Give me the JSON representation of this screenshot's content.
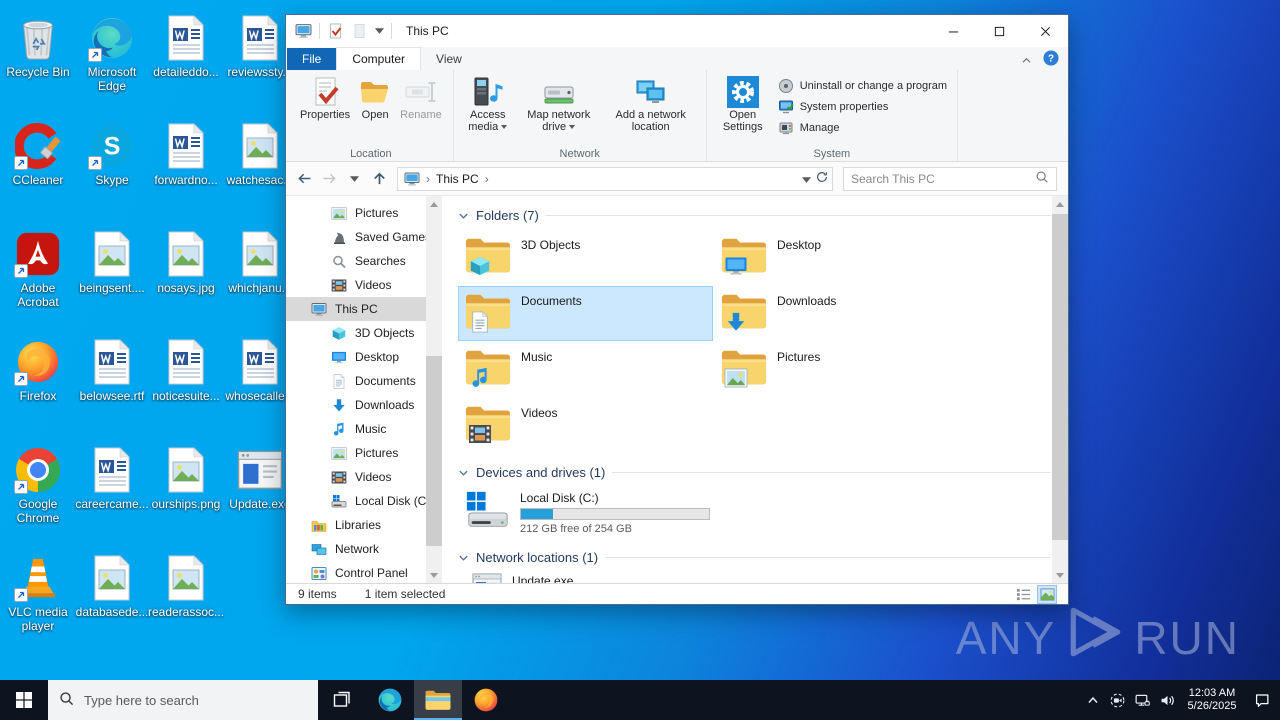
{
  "desktop": {
    "watermark_left": "ANY",
    "watermark_right": "RUN",
    "icons": [
      {
        "label": "Recycle Bin",
        "icon": "recycle-bin",
        "col": 0,
        "row": 0
      },
      {
        "label": "Microsoft Edge",
        "icon": "edge",
        "col": 1,
        "row": 0,
        "shortcut": true
      },
      {
        "label": "detaileddo...",
        "icon": "word-doc",
        "col": 2,
        "row": 0
      },
      {
        "label": "reviewssty...",
        "icon": "word-doc",
        "col": 3,
        "row": 0
      },
      {
        "label": "CCleaner",
        "icon": "ccleaner",
        "col": 0,
        "row": 1,
        "shortcut": true
      },
      {
        "label": "Skype",
        "icon": "skype",
        "col": 1,
        "row": 1,
        "shortcut": true
      },
      {
        "label": "forwardno...",
        "icon": "word-doc",
        "col": 2,
        "row": 1
      },
      {
        "label": "watchesac...",
        "icon": "image-file",
        "col": 3,
        "row": 1
      },
      {
        "label": "Adobe Acrobat",
        "icon": "adobe",
        "col": 0,
        "row": 2,
        "shortcut": true
      },
      {
        "label": "beingsent....",
        "icon": "image-file",
        "col": 1,
        "row": 2
      },
      {
        "label": "nosays.jpg",
        "icon": "image-file",
        "col": 2,
        "row": 2
      },
      {
        "label": "whichjanu...",
        "icon": "image-file",
        "col": 3,
        "row": 2
      },
      {
        "label": "Firefox",
        "icon": "firefox",
        "col": 0,
        "row": 3,
        "shortcut": true
      },
      {
        "label": "belowsee.rtf",
        "icon": "word-doc",
        "col": 1,
        "row": 3
      },
      {
        "label": "noticesuite...",
        "icon": "word-doc",
        "col": 2,
        "row": 3
      },
      {
        "label": "whosecalle...",
        "icon": "word-doc",
        "col": 3,
        "row": 3
      },
      {
        "label": "Google Chrome",
        "icon": "chrome",
        "col": 0,
        "row": 4,
        "shortcut": true
      },
      {
        "label": "careercame...",
        "icon": "word-doc",
        "col": 1,
        "row": 4
      },
      {
        "label": "ourships.png",
        "icon": "image-file",
        "col": 2,
        "row": 4
      },
      {
        "label": "Update.exe",
        "icon": "exe-window",
        "col": 3,
        "row": 4
      },
      {
        "label": "VLC media player",
        "icon": "vlc",
        "col": 0,
        "row": 5,
        "shortcut": true
      },
      {
        "label": "databasede...",
        "icon": "image-file",
        "col": 1,
        "row": 5
      },
      {
        "label": "readerassoc...",
        "icon": "image-file",
        "col": 2,
        "row": 5
      }
    ]
  },
  "window": {
    "title": "This PC",
    "tabs": {
      "file": "File",
      "computer": "Computer",
      "view": "View"
    },
    "ribbon": {
      "groups": [
        {
          "name": "Location",
          "buttons": [
            {
              "label": "Properties",
              "icon": "properties"
            },
            {
              "label": "Open",
              "icon": "open-folder"
            },
            {
              "label": "Rename",
              "icon": "rename",
              "disabled": true
            }
          ]
        },
        {
          "name": "Network",
          "buttons": [
            {
              "label": "Access media",
              "icon": "access-media",
              "menu": true
            },
            {
              "label": "Map network drive",
              "icon": "map-drive",
              "menu": true
            },
            {
              "label": "Add a network location",
              "icon": "add-network"
            }
          ]
        },
        {
          "name": "System",
          "buttons": [
            {
              "label": "Open Settings",
              "icon": "settings-gear"
            }
          ],
          "small_buttons": [
            {
              "label": "Uninstall or change a program",
              "icon": "uninstall"
            },
            {
              "label": "System properties",
              "icon": "sysprops"
            },
            {
              "label": "Manage",
              "icon": "manage"
            }
          ]
        }
      ]
    },
    "address": {
      "crumb": "This PC",
      "search_placeholder": "Search This PC"
    },
    "sidebar": {
      "items": [
        {
          "label": "Pictures",
          "icon": "pictures",
          "level": 2
        },
        {
          "label": "Saved Games",
          "icon": "saved-games",
          "level": 2
        },
        {
          "label": "Searches",
          "icon": "searches",
          "level": 2
        },
        {
          "label": "Videos",
          "icon": "videos",
          "level": 2
        },
        {
          "label": "This PC",
          "icon": "this-pc",
          "level": 1,
          "selected": true
        },
        {
          "label": "3D Objects",
          "icon": "3d-objects",
          "level": 2
        },
        {
          "label": "Desktop",
          "icon": "desktop",
          "level": 2
        },
        {
          "label": "Documents",
          "icon": "documents",
          "level": 2
        },
        {
          "label": "Downloads",
          "icon": "downloads",
          "level": 2
        },
        {
          "label": "Music",
          "icon": "music",
          "level": 2
        },
        {
          "label": "Pictures",
          "icon": "pictures",
          "level": 2
        },
        {
          "label": "Videos",
          "icon": "videos",
          "level": 2
        },
        {
          "label": "Local Disk (C:)",
          "icon": "local-disk",
          "level": 2
        },
        {
          "label": "Libraries",
          "icon": "libraries",
          "level": 1
        },
        {
          "label": "Network",
          "icon": "network",
          "level": 1
        },
        {
          "label": "Control Panel",
          "icon": "control-panel",
          "level": 1
        }
      ]
    },
    "content": {
      "folders": {
        "title": "Folders (7)",
        "items": [
          {
            "label": "3D Objects",
            "icon": "3d-objects"
          },
          {
            "label": "Desktop",
            "icon": "desktop"
          },
          {
            "label": "Documents",
            "icon": "documents",
            "selected": true
          },
          {
            "label": "Downloads",
            "icon": "downloads"
          },
          {
            "label": "Music",
            "icon": "music"
          },
          {
            "label": "Pictures",
            "icon": "pictures"
          },
          {
            "label": "Videos",
            "icon": "videos"
          }
        ]
      },
      "devices": {
        "title": "Devices and drives (1)",
        "drive": {
          "label": "Local Disk (C:)",
          "detail": "212 GB free of 254 GB",
          "used_pct": 17
        }
      },
      "network_locations": {
        "title": "Network locations (1)",
        "items": [
          {
            "label": "Update.exe",
            "icon": "exe-window"
          }
        ]
      }
    },
    "statusbar": {
      "count": "9 items",
      "selected": "1 item selected"
    }
  },
  "taskbar": {
    "search_placeholder": "Type here to search",
    "clock": {
      "time": "12:03 AM",
      "date": "5/26/2025"
    }
  },
  "colors": {
    "accent_blue": "#1266b6",
    "selection_fill": "#cbe8ff",
    "selection_border": "#99d1ff",
    "disk_bar": "#26a0da"
  }
}
